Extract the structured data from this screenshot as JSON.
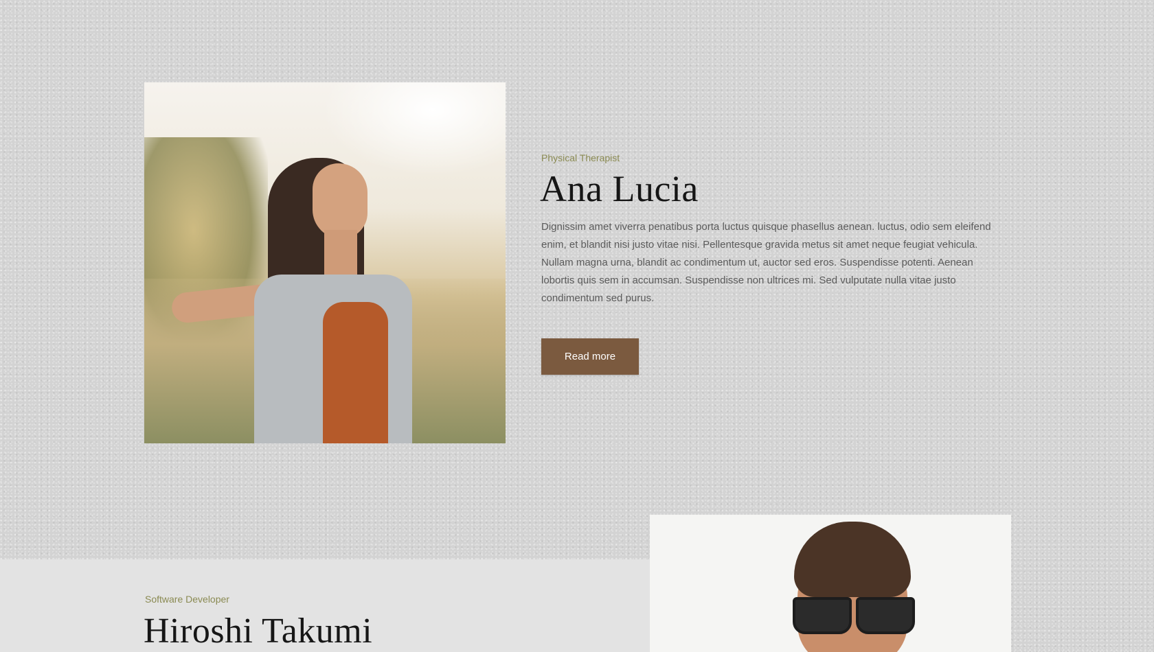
{
  "profiles": [
    {
      "role": "Physical Therapist",
      "name": "Ana Lucia",
      "bio": "Dignissim amet viverra penatibus porta luctus quisque phasellus aenean. luctus, odio sem eleifend enim, et blandit nisi justo vitae nisi. Pellentesque gravida metus sit amet neque feugiat vehicula. Nullam magna urna, blandit ac condimentum ut, auctor sed eros. Suspendisse potenti. Aenean lobortis quis sem in accumsan. Suspendisse non ultrices mi. Sed vulputate nulla vitae justo condimentum sed purus.",
      "button_label": "Read more"
    },
    {
      "role": "Software Developer",
      "name": "Hiroshi Takumi"
    }
  ],
  "colors": {
    "button_bg": "#7b5a3f",
    "role_text": "#8a8a52",
    "page_bg": "#d3d3d3"
  }
}
